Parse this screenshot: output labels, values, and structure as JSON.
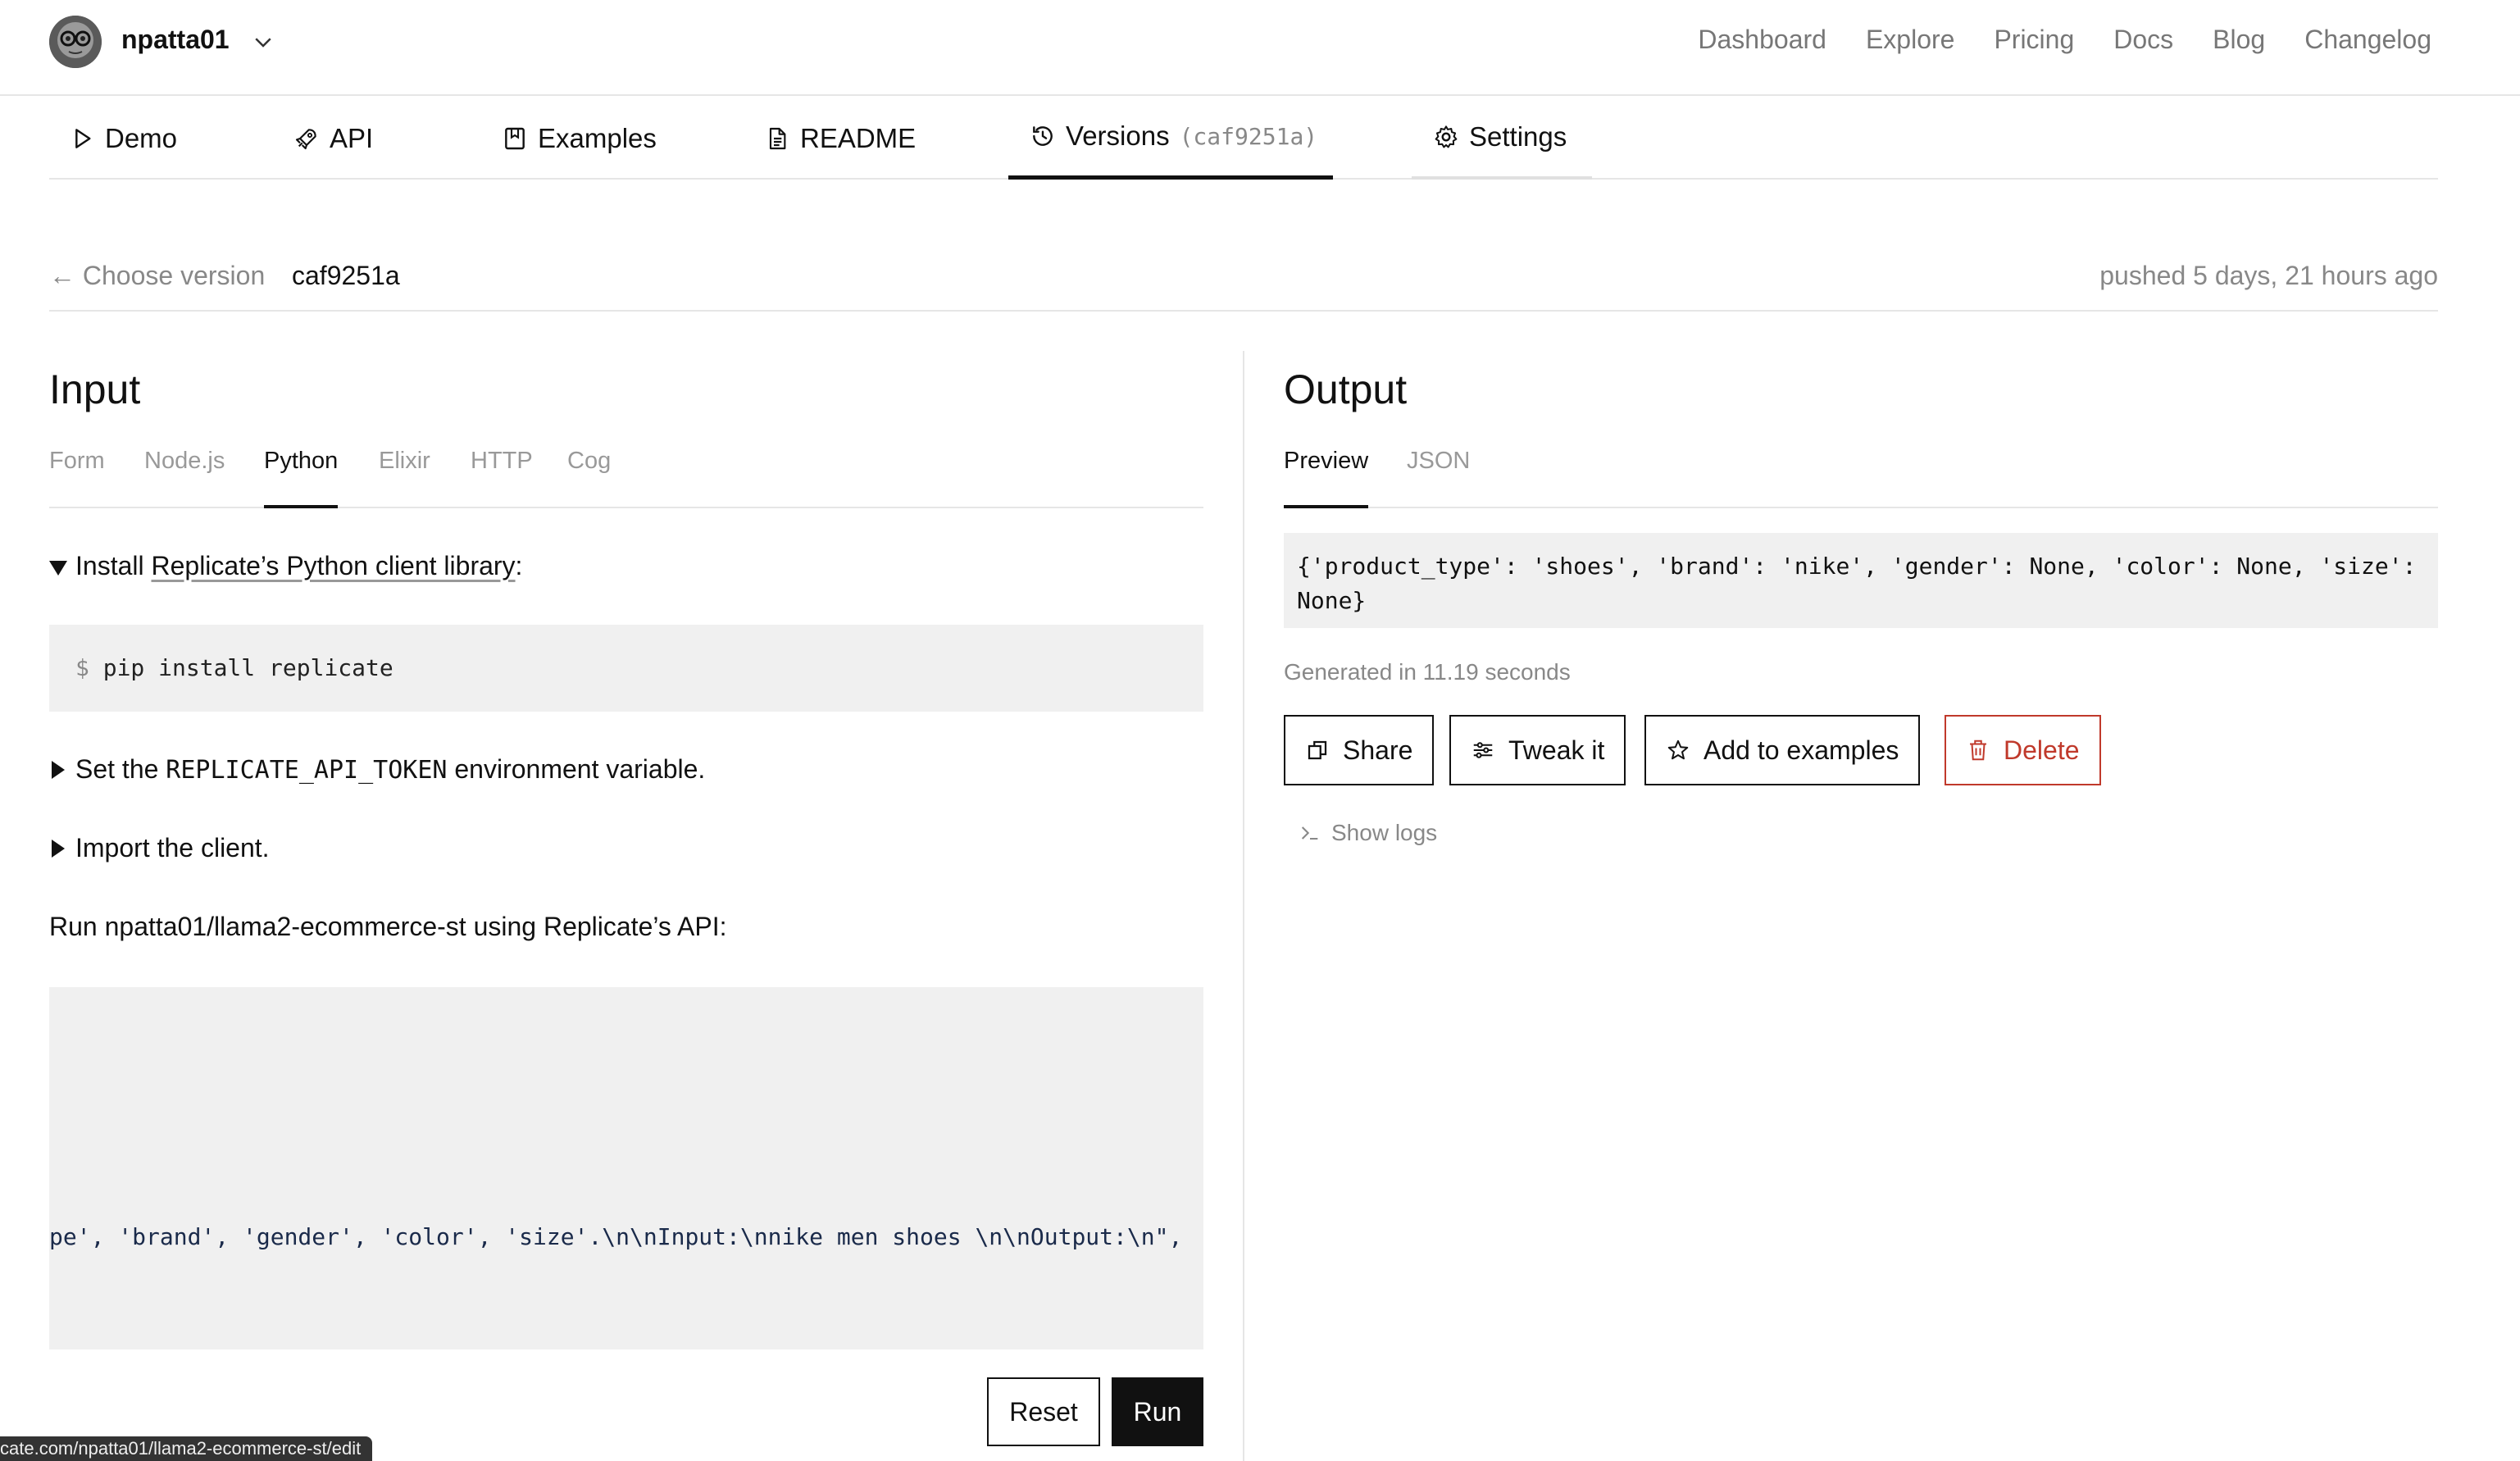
{
  "user": {
    "name": "npatta01"
  },
  "topnav": [
    "Dashboard",
    "Explore",
    "Pricing",
    "Docs",
    "Blog",
    "Changelog"
  ],
  "tabs": {
    "demo": "Demo",
    "api": "API",
    "examples": "Examples",
    "readme": "README",
    "versions": "Versions",
    "versions_hash": "(caf9251a)",
    "settings": "Settings"
  },
  "version": {
    "choose": "← Choose version",
    "hash": "caf9251a",
    "pushed": "pushed 5 days, 21 hours ago"
  },
  "input": {
    "title": "Input",
    "tabs": [
      "Form",
      "Node.js",
      "Python",
      "Elixir",
      "HTTP",
      "Cog"
    ],
    "active_tab": "Python",
    "install_prefix": "Install ",
    "install_link": "Replicate’s Python client library",
    "install_suffix": ":",
    "pip_prompt": "$",
    "pip_cmd": "pip install replicate",
    "env_prefix": "Set the ",
    "env_var": "REPLICATE_API_TOKEN",
    "env_suffix": " environment variable.",
    "import_line": "Import the client.",
    "run_line": "Run npatta01/llama2-ecommerce-st using Replicate’s API:",
    "code_visible": "pe', 'brand', 'gender', 'color', 'size'.\\n\\nInput:\\nnike men shoes \\n\\nOutput:\\n\",",
    "reset": "Reset",
    "run": "Run"
  },
  "output": {
    "title": "Output",
    "tabs": [
      "Preview",
      "JSON"
    ],
    "active_tab": "Preview",
    "result": "{'product_type': 'shoes', 'brand': 'nike', 'gender': None, 'color': None, 'size': None}",
    "generated": "Generated in 11.19 seconds",
    "share": "Share",
    "tweak": "Tweak it",
    "add_examples": "Add to examples",
    "delete": "Delete",
    "show_logs": "Show logs"
  },
  "status_url": "cate.com/npatta01/llama2-ecommerce-st/edit",
  "colors": {
    "accent": "#111111",
    "danger": "#c0392b",
    "muted": "#888888",
    "code_bg": "#f0f0f0"
  }
}
